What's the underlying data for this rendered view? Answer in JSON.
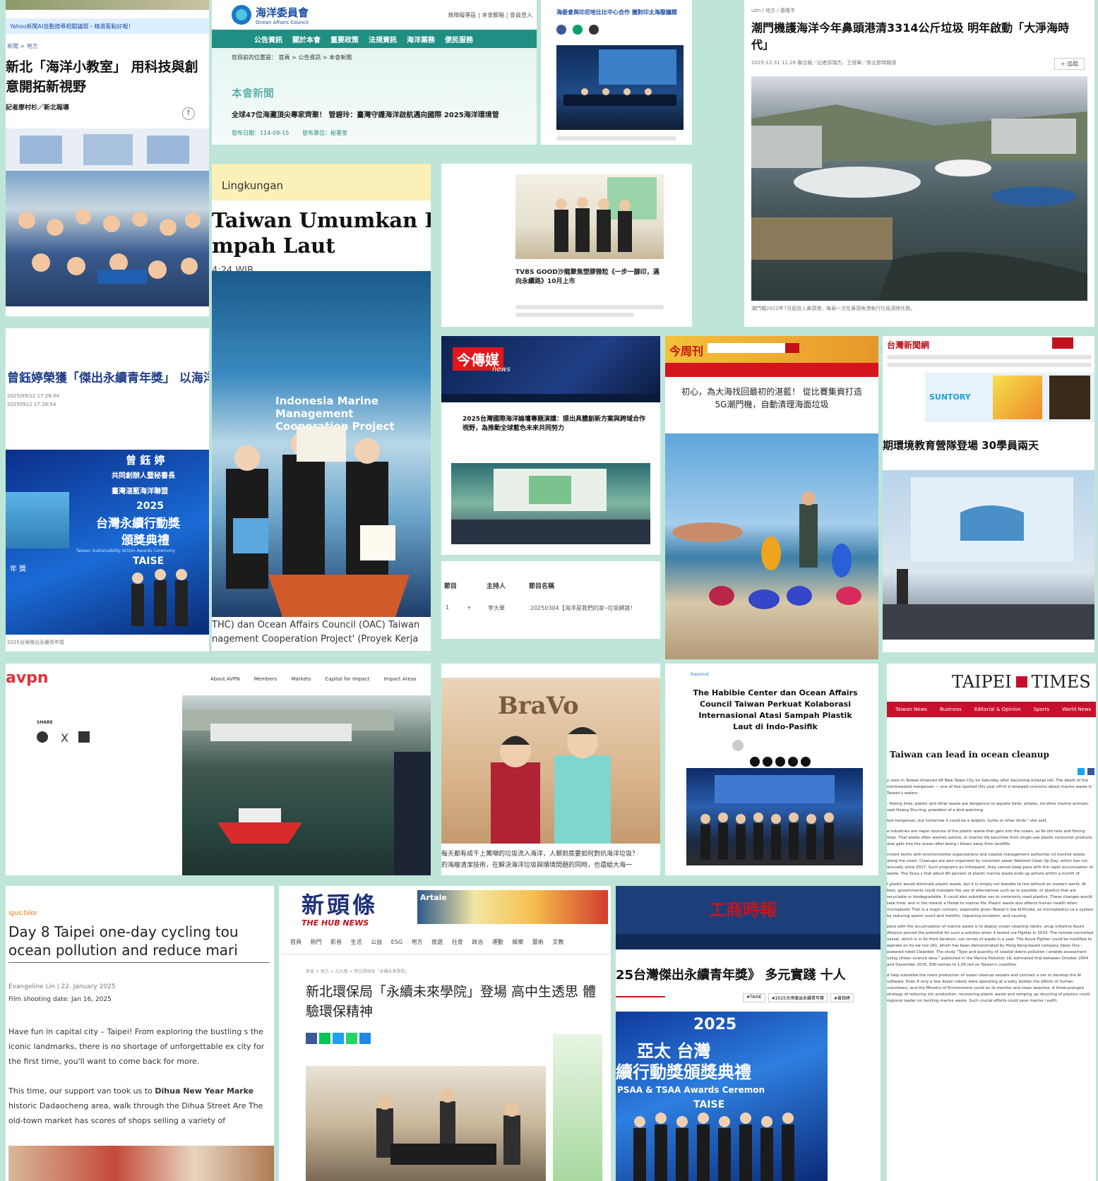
{
  "t1": {
    "crumb": "Yahoo新聞AI自動搜尋相關議題・精選看點好報！",
    "breadcrumb": "新聞 > 地方",
    "title": "新北「海洋小教室」 用科技與創意開拓新視野",
    "author": "記者廖村杉／新北報導"
  },
  "t2": {
    "logo_cn": "海洋委員會",
    "logo_en": "Ocean Affairs Council",
    "topright": "無障礙專區 | 本會郵箱 | 會員登入",
    "nav": [
      "公告資訊",
      "關於本會",
      "重要政策",
      "法規資訊",
      "海洋業務",
      "便民服務"
    ],
    "crumb": "您目前的位置是： 首頁 > 公告資訊 > 本會新聞",
    "section": "本會新聞",
    "headline": "全球47位海灘頂尖專家齊聚！ 管碧玲：臺灣守護海洋啟航邁向國際 2025海洋環境管",
    "date": "發布日期：114-09-15",
    "unit": "發布單位：秘書室"
  },
  "t3": {
    "headline": "海委會與印尼哈比比中心合作 攜對印太海廢議題"
  },
  "t4": {
    "crumb": "udn / 地方 / 基隆市",
    "title": "潮門機護海洋今年鼻頭港清3314公斤垃圾 明年啟動「大淨海時代」",
    "meta": "2025-12-31 11:26 聯合報／記者邱瑞杰、王燈華／新北即時報導",
    "caption": "潮門機2022年7月起投入鼻頭港，每兩一次在鼻頭魚港執行垃圾清除任務。"
  },
  "t5": {
    "title": "曾鈺婷榮獲「傑出永續青年獎」 以海洋、鏈結國際永續",
    "date1": "2025/09/12 17:28:04",
    "date2": "20250912 17:28:54",
    "banner_name": "曾 鈺 婷",
    "banner_role1": "共同創辦人暨秘書長",
    "banner_role2": "臺灣湛藍海洋聯盟",
    "banner_year": "2025",
    "banner_title1": "台灣永續行動獎",
    "banner_title2": "頒獎典禮",
    "banner_en": "Taiwan Sustainability Action Awards Ceremony",
    "banner_taise": "TAISE",
    "banner_tag": "年 獎",
    "caption": "2025台灣傑出永續青年獎"
  },
  "t6": {
    "category": "Lingkungan",
    "title1": "Taiwan Umumkan Ke",
    "title2": "mpah Laut",
    "time": "4:24 WIB",
    "caption1": "THC) dan Ocean Affairs Council (OAC) Taiwan",
    "caption2": "nagement Cooperation Project' (Proyek Kerja",
    "stage1": "Indonesia Marine",
    "stage2": "Management",
    "stage3": "Cooperation Project"
  },
  "t7": {
    "title": "TVBS GOOD沙龍聚焦塑膠微粒《一步一腳印，邁向永續路》10月上市"
  },
  "t8": {
    "logo": "今傳媒",
    "logo_sub": "news",
    "title": "2025台灣國際海洋論壇專題演講：提出具體創新方案與跨域合作視野，為推動全球藍色未來共同努力"
  },
  "t9": {
    "logo": "今周刊",
    "title": "初心，為大海找回最初的湛藍！ 從比賽集資打造5G潮門機，自動清理海面垃圾"
  },
  "t10": {
    "logo": "台灣新聞網",
    "banner_brand": "SUNTORY",
    "title": "期環境教育營隊登場 30學員兩天"
  },
  "t11": {
    "col1": "節目",
    "col2": "主持人",
    "col3": "節目名稱",
    "row_num": "1",
    "row_host": "李大華",
    "row_title": "20250304【海洋是我們的家─垃圾歸誰！"
  },
  "t12": {
    "logo": "avpn",
    "nav": [
      "About AVPN",
      "Members",
      "Markets",
      "Capital for Impact",
      "Impact Areas"
    ],
    "share": "SHARE"
  },
  "t13": {
    "sign": "BraVo",
    "caption": "每天都有成千上萬噸的垃圾流入海洋，人類到底要如何對抗海洋垃圾？",
    "caption2": "的海廢清潔技術，在解決海洋垃圾與環境問題的同時，也還給大海一"
  },
  "t14": {
    "category": "Nasional",
    "title": "The Habibie Center dan Ocean Affairs Council Taiwan Perkuat Kolaborasi Internasional Atasi Sampah Plastik Laut di Indo-Pasifik"
  },
  "t15": {
    "logo_left": "TAIPEI",
    "logo_right": "TIMES",
    "nav": [
      "Taiwan News",
      "Business",
      "Editorial & Opinion",
      "Sports",
      "World News"
    ],
    "title": "Taiwan can lead in ocean cleanup",
    "p1": "y seen in Taiwan drowned off New Taipei City on Saturday after becoming entangl net. The death of the red-breasted merganser — one of five spotted this year off th d renewed concerns about marine waste in Taiwan's waters.",
    "p2": ", fishing lines, plastic and other waste are dangerous to aquatic birds, whales, nd other marine animals, said Huang Shu-ling, president of a bird-watching",
    "p3": "ted merganser, but tomorrow it could be a dolphin, turtle or other birds,\" she said.",
    "p4": "e industries are major sources of the plastic waste that gets into the ocean, as fis old nets and fishing lines. That waste often washes ashore, or marine life becomes from single-use plastic consumer products also gets into the ocean after being r blown away from landfills.",
    "p5": "nment works with environmental organizations and coastal management authoritie nd monitor waste along the coast. Cleanups are also organized by volunteer aiwan National Clean Up Day, which has run annually since 2017. Such programs an infrequent, they cannot keep pace with the rapid accumulation of waste. The Ocea s that about 80 percent of plastic marine waste ends up ashore within a month of",
    "p6": "f plastic would eliminate plastic waste, but it is simply not feasible to live without an modern world. At best, governments could mandate the use of alternatives such as re possible, or plastics that are recyclable or biodegradable. It could also subsidize ves to commonly used plastics. These changes would take time, and in the meanti a threat to marine life. Plastic waste also affects human health when microplastic That is a major concern, especially given Taiwan's low birthrate, as microplastics ca e system by reducing sperm count and motility, impairing ovulation, and causing",
    "p7": "pace with the accumulation of marine waste is to deploy ocean-cleaning robots. anup initiative Azure Alliance proved the potential for such a solution when it tested ure Fighter in 2019. The remote-controlled vessel, which is in its third iteration, can onnes of waste in a year. The Azure Fighter could be modified to operate on its ow nce (AI), which has been demonstrated by Hong Kong-based company Open Oce -powered robot Cleanbot. The study \"Type and quantity of coastal debris pollution i onwide assessment using citizen science data,\" published in the Marine Pollution 18, estimated that between October 2004 and December 2016, 930 tonnes to 1,00 red on Taiwan's coastline.",
    "p8": "d help subsidize the mass production of ocean cleanup vessels and contract a ner to develop the AI software. Even if only a few dozen robots were operating at a eatly bolster the efforts of human volunteers, and the Ministry of Environment could on to monitor and clean beaches. A three-pronged strategy of reducing stic production, recovering plastic waste and ramping up recycling of plastics could regional leader on tackling marine waste. Such crucial efforts could save marine l ealth."
  },
  "t16": {
    "brand": "igus:bike",
    "title1": "Day 8 Taipei one-day cycling tou",
    "title2": "ocean pollution and reduce mari",
    "byline": "Evangeline Lin | 22. January 2025",
    "filmed": "Film shooting date: Jan 16, 2025",
    "p1": "Have fun in capital city – Taipei! From exploring the bustling s the iconic landmarks, there is no shortage of unforgettable ex city for the first time, you'll want to come back for more.",
    "p2a": "This time, our support van took us to ",
    "p2b": "Dihua New Year Marke",
    "p2c": " historic Dadaocheng area, walk through the Dihua Street Are The old-town market has scores of shops selling a variety of"
  },
  "t17": {
    "logo_cn": "新頭條",
    "logo_en": "THE HUB NEWS",
    "ad": "Artale",
    "nav": [
      "首頁",
      "熱門",
      "影音",
      "生活",
      "公益",
      "ESG",
      "地方",
      "旅遊",
      "社會",
      "政治",
      "運動",
      "娛樂",
      "藝術",
      "文教"
    ],
    "title": "新北環保局「永續未來學院」登場 高中生透思 體驗環保精神",
    "crumb": "首頁 > 地方 > 北北基 > 新北環保局「永續未來學院」"
  },
  "t18": {
    "logo": "工商時報",
    "title": "25台灣傑出永續青年獎》 多元實踐 十人",
    "tags": [
      "#TAISE",
      "#2025台灣傑出永續青年獎",
      "#曾鈺婷"
    ],
    "banner_year": "2025",
    "banner_line1": "亞太 台灣",
    "banner_line2": "續行動獎頒獎典禮",
    "banner_en": "PSAA & TSAA Awards Ceremon",
    "banner_taise": "TAISE"
  },
  "colors": {
    "mint": "#bfe5d9",
    "taipei_red": "#c8102e",
    "now_red": "#d9161c",
    "ctee_red": "#c4161c",
    "hub_blue": "#1c2f7a"
  }
}
